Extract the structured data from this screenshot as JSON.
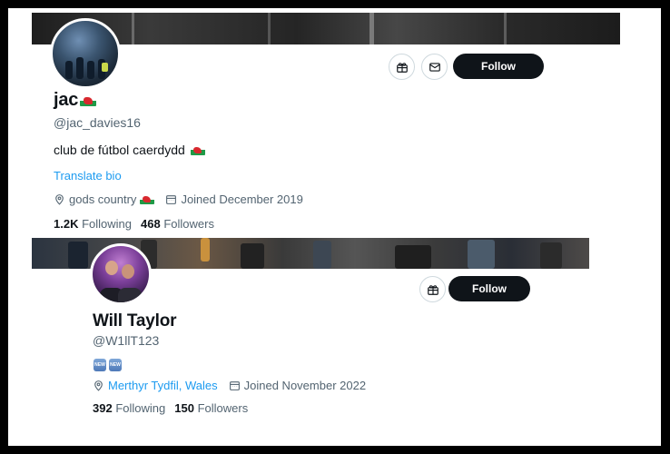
{
  "profile1": {
    "name": "jac",
    "handle": "@jac_davies16",
    "bio": "club de fútbol caerdydd",
    "translate_label": "Translate bio",
    "location": "gods country",
    "joined": "Joined December 2019",
    "following_count": "1.2K",
    "following_label": "Following",
    "followers_count": "468",
    "followers_label": "Followers",
    "follow_label": "Follow",
    "icons": [
      "gift-icon",
      "mail-icon",
      "location-pin-icon",
      "calendar-icon",
      "wales-flag-icon"
    ]
  },
  "profile2": {
    "name": "Will Taylor",
    "handle": "@W1llT123",
    "badges": [
      "NEW",
      "NEW"
    ],
    "location": "Merthyr Tydfil, Wales",
    "joined": "Joined November 2022",
    "following_count": "392",
    "following_label": "Following",
    "followers_count": "150",
    "followers_label": "Followers",
    "follow_label": "Follow",
    "icons": [
      "gift-icon",
      "location-pin-icon",
      "calendar-icon"
    ]
  },
  "colors": {
    "accent": "#1d9bf0",
    "button_bg": "#0f1419",
    "secondary_text": "#536471",
    "border": "#cfd9de"
  }
}
